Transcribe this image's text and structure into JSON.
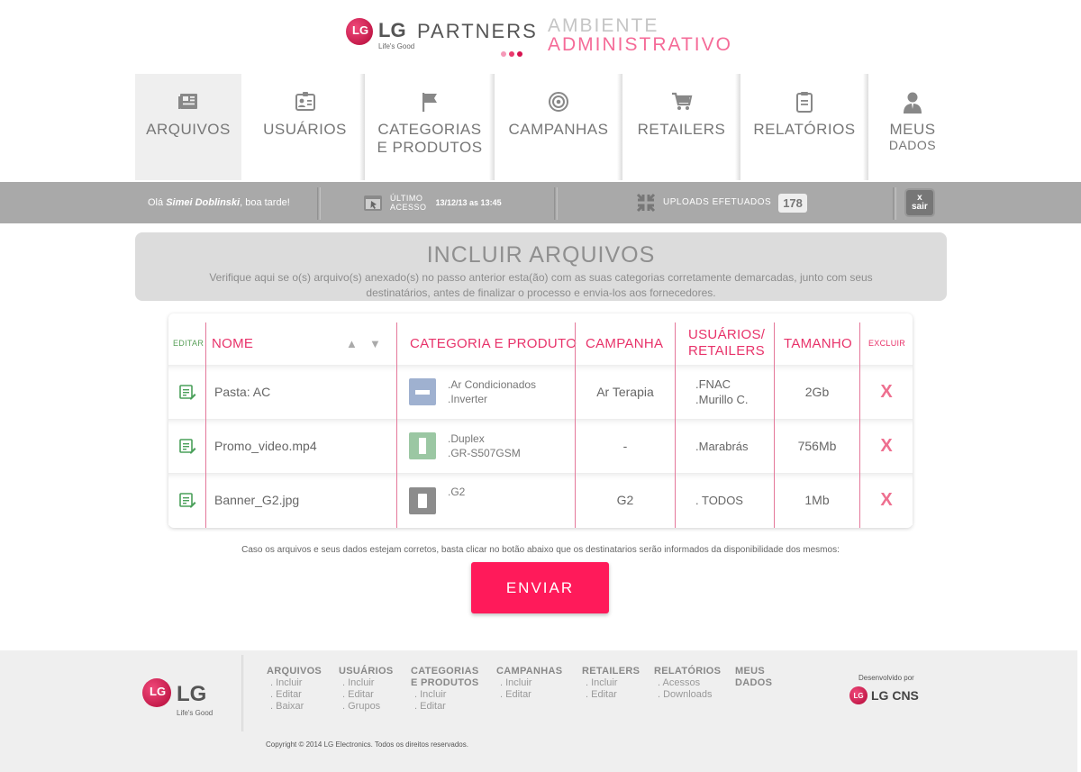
{
  "header": {
    "logo_mark": "LG",
    "logo_word": "LG",
    "logo_tagline": "Life's Good",
    "partners": "PARTNERS",
    "env_line1": "AMBIENTE",
    "env_line2": "ADMINISTRATIVO"
  },
  "nav": [
    {
      "label": "ARQUIVOS",
      "icon": "files-icon",
      "active": true
    },
    {
      "label": "USUÁRIOS",
      "icon": "id-card-icon"
    },
    {
      "label": "CATEGORIAS",
      "label2": "E PRODUTOS",
      "icon": "flag-icon"
    },
    {
      "label": "CAMPANHAS",
      "icon": "target-icon"
    },
    {
      "label": "RETAILERS",
      "icon": "cart-icon"
    },
    {
      "label": "RELATÓRIOS",
      "icon": "clipboard-icon"
    },
    {
      "label": "MEUS",
      "sub": "DADOS",
      "icon": "user-icon"
    }
  ],
  "status": {
    "greeting_prefix": "Olá",
    "user_name": "Simei Doblinski",
    "greeting_suffix": ", boa tarde!",
    "last_access_label1": "ÚLTIMO",
    "last_access_label2": "ACESSO",
    "last_access_value": "13/12/13 as 13:45",
    "uploads_label": "UPLOADS EFETUADOS",
    "uploads_count": "178",
    "logout_x": "x",
    "logout_label": "sair"
  },
  "section": {
    "title": "INCLUIR ARQUIVOS",
    "description": "Verifique aqui se o(s) arquivo(s) anexado(s) no passo anterior esta(ão) com as suas categorias corretamente demarcadas, junto com seus destinatários, antes de finalizar o processo e envia-los aos fornecedores."
  },
  "table": {
    "headers": {
      "edit": "EDITAR",
      "name": "NOME",
      "sort_up": "▲",
      "sort_down": "▼",
      "category": "CATEGORIA E PRODUTO",
      "campaign": "CAMPANHA",
      "users_line1": "USUÁRIOS/",
      "users_line2": "RETAILERS",
      "size": "TAMANHO",
      "delete": "EXCLUIR"
    },
    "rows": [
      {
        "name": "Pasta: AC",
        "cat1": ".Ar Condicionados",
        "cat2": ".Inverter",
        "thumb": "ac-thumb",
        "thumb_color": "#9fb1d0",
        "campaign": "Ar Terapia",
        "users1": ".FNAC",
        "users2": ".Murillo C.",
        "size": "2Gb",
        "delete": "X"
      },
      {
        "name": "Promo_video.mp4",
        "cat1": ".Duplex",
        "cat2": ".GR-S507GSM",
        "thumb": "fridge-thumb",
        "thumb_color": "#9bc7a3",
        "campaign": "-",
        "users1": ".Marabrás",
        "users2": "",
        "size": "756Mb",
        "delete": "X"
      },
      {
        "name": "Banner_G2.jpg",
        "cat1": ".G2",
        "cat2": "",
        "thumb": "phone-thumb",
        "thumb_color": "#8c8c8c",
        "campaign": "G2",
        "users1": ". TODOS",
        "users2": "",
        "size": "1Mb",
        "delete": "X"
      }
    ]
  },
  "note": "Caso os arquivos e seus dados estejam corretos, basta clicar no botão abaixo que os destinatarios serão informados da disponibilidade dos mesmos:",
  "send_button": "ENVIAR",
  "footer": {
    "logo_mark": "LG",
    "logo_word": "LG",
    "logo_tagline": "Life's Good",
    "cols": [
      {
        "h1": "ARQUIVOS",
        "h2": "",
        "items": [
          ". Incluir",
          ". Editar",
          ". Baixar"
        ]
      },
      {
        "h1": "USUÁRIOS",
        "h2": "",
        "items": [
          ". Incluir",
          ". Editar",
          ". Grupos"
        ]
      },
      {
        "h1": "CATEGORIAS",
        "h2": "E PRODUTOS",
        "items": [
          ". Incluir",
          ". Editar"
        ]
      },
      {
        "h1": "CAMPANHAS",
        "h2": "",
        "items": [
          ". Incluir",
          ". Editar"
        ]
      },
      {
        "h1": "RETAILERS",
        "h2": "",
        "items": [
          ". Incluir",
          ". Editar"
        ]
      },
      {
        "h1": "RELATÓRIOS",
        "h2": "",
        "items": [
          ". Acessos",
          ". Downloads"
        ]
      },
      {
        "h1": "MEUS",
        "h2": "DADOS",
        "items": []
      }
    ],
    "developed_by": "Desenvolvido por",
    "cns_mark": "LG",
    "cns_word": "LG CNS",
    "copyright": "Copyright © 2014 LG Electronics. Todos os direitos reservados."
  },
  "colors": {
    "accent": "#ff1a5a",
    "header_pink": "#e8336a",
    "status_bg": "#a9a9a9"
  }
}
